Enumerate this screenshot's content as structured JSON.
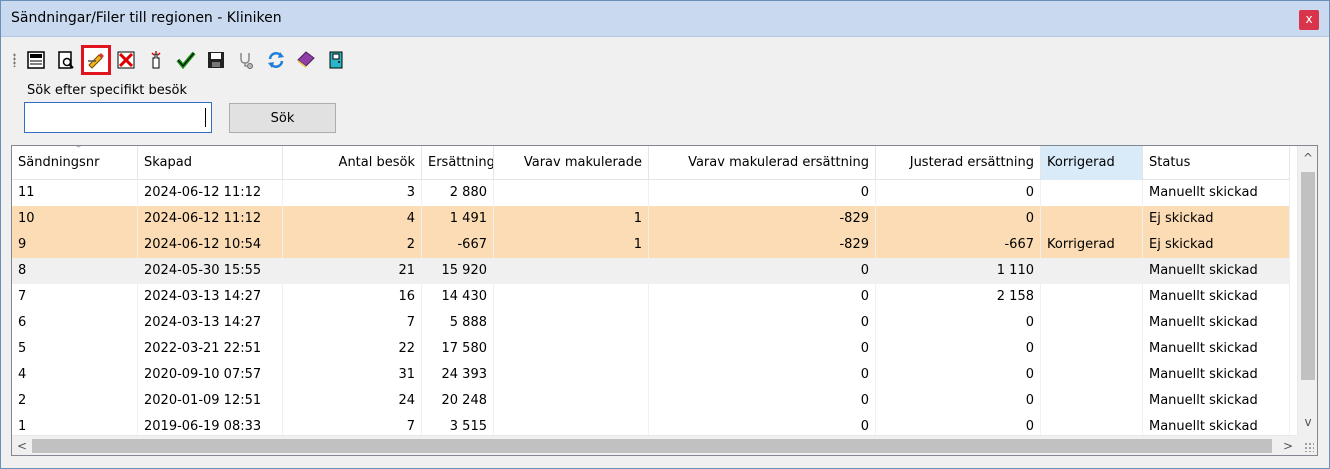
{
  "window": {
    "title": "Sändningar/Filer till regionen - Kliniken",
    "close_label": "x"
  },
  "toolbar": {
    "icons": [
      "print-icon",
      "print-preview-icon",
      "edit-correct-icon",
      "delete-icon",
      "send-icon",
      "approve-check-icon",
      "save-icon",
      "stethoscope-icon",
      "refresh-icon",
      "book-icon",
      "exit-door-icon"
    ],
    "highlighted": "edit-correct-icon",
    "highlight_color": "#e0141e"
  },
  "search": {
    "label": "Sök efter specifikt besök",
    "value": "",
    "button_label": "Sök"
  },
  "table": {
    "columns": [
      "Sändningsnr",
      "Skapad",
      "Antal besök",
      "Ersättning",
      "Varav makulerade",
      "Varav makulerad ersättning",
      "Justerad ersättning",
      "Korrigerad",
      "Status"
    ],
    "rows": [
      [
        "11",
        "2024-06-12 11:12",
        "3",
        "2 880",
        "",
        "0",
        "0",
        "",
        "Manuellt skickad"
      ],
      [
        "10",
        "2024-06-12 11:12",
        "4",
        "1 491",
        "1",
        "-829",
        "0",
        "",
        "Ej skickad"
      ],
      [
        "9",
        "2024-06-12 10:54",
        "2",
        "-667",
        "1",
        "-829",
        "-667",
        "Korrigerad",
        "Ej skickad"
      ],
      [
        "8",
        "2024-05-30 15:55",
        "21",
        "15 920",
        "",
        "0",
        "1 110",
        "",
        "Manuellt skickad"
      ],
      [
        "7",
        "2024-03-13 14:27",
        "16",
        "14 430",
        "",
        "0",
        "2 158",
        "",
        "Manuellt skickad"
      ],
      [
        "6",
        "2024-03-13 14:27",
        "7",
        "5 888",
        "",
        "0",
        "0",
        "",
        "Manuellt skickad"
      ],
      [
        "5",
        "2022-03-21 22:51",
        "22",
        "17 580",
        "",
        "0",
        "0",
        "",
        "Manuellt skickad"
      ],
      [
        "4",
        "2020-09-10 07:57",
        "31",
        "24 393",
        "",
        "0",
        "0",
        "",
        "Manuellt skickad"
      ],
      [
        "2",
        "2020-01-09 12:51",
        "24",
        "20 248",
        "",
        "0",
        "0",
        "",
        "Manuellt skickad"
      ],
      [
        "1",
        "2019-06-19 08:33",
        "7",
        "3 515",
        "",
        "0",
        "0",
        "",
        "Manuellt skickad"
      ]
    ],
    "highlight_rows": [
      1,
      2
    ],
    "selected_row": 3,
    "highlight_color": "#fcdcb4"
  }
}
